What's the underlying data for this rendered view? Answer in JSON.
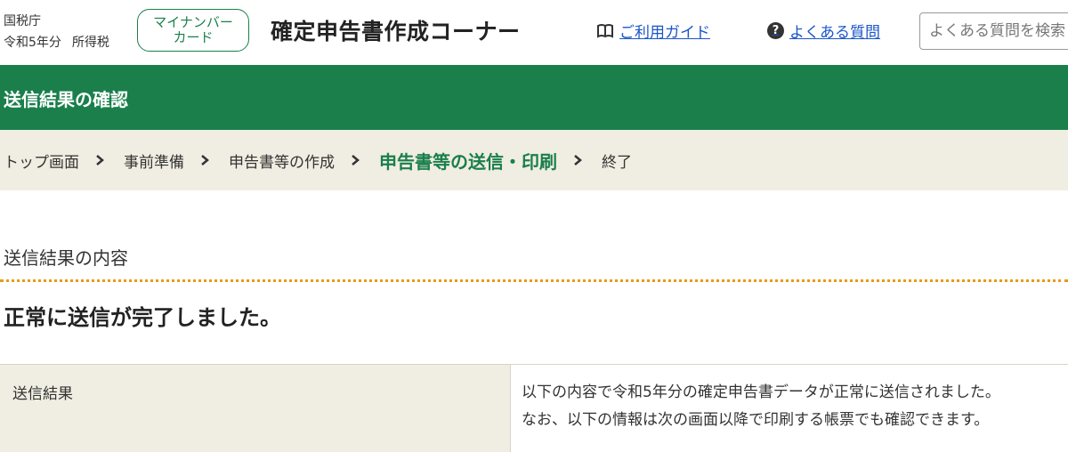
{
  "header": {
    "agency": "国税庁",
    "year": "令和5年分",
    "tax_type": "所得税",
    "mynumber_button": [
      "マイナンバー",
      "カード"
    ],
    "site_title": "確定申告書作成コーナー",
    "guide_link": "ご利用ガイド",
    "guide_icon": "book-icon",
    "faq_link": "よくある質問",
    "faq_icon": "question-circle-icon",
    "search_placeholder": "よくある質問を検索"
  },
  "title_bar": {
    "title": "送信結果の確認",
    "color": "#1a7f4b"
  },
  "breadcrumb": {
    "steps": [
      "トップ画面",
      "事前準備",
      "申告書等の作成",
      "申告書等の送信・印刷",
      "終了"
    ],
    "current_index": 3
  },
  "content": {
    "section_heading": "送信結果の内容",
    "complete_message": "正常に送信が完了しました。",
    "table": {
      "label": "送信結果",
      "lines": [
        "以下の内容で令和5年分の確定申告書データが正常に送信されました。",
        "なお、以下の情報は次の画面以降で印刷する帳票でも確認できます。"
      ]
    }
  },
  "colors": {
    "accent_green": "#1a7f4b",
    "link_blue": "#1a56c8",
    "breadcrumb_bg": "#f0ede2",
    "divider_orange": "#e69a1c"
  }
}
